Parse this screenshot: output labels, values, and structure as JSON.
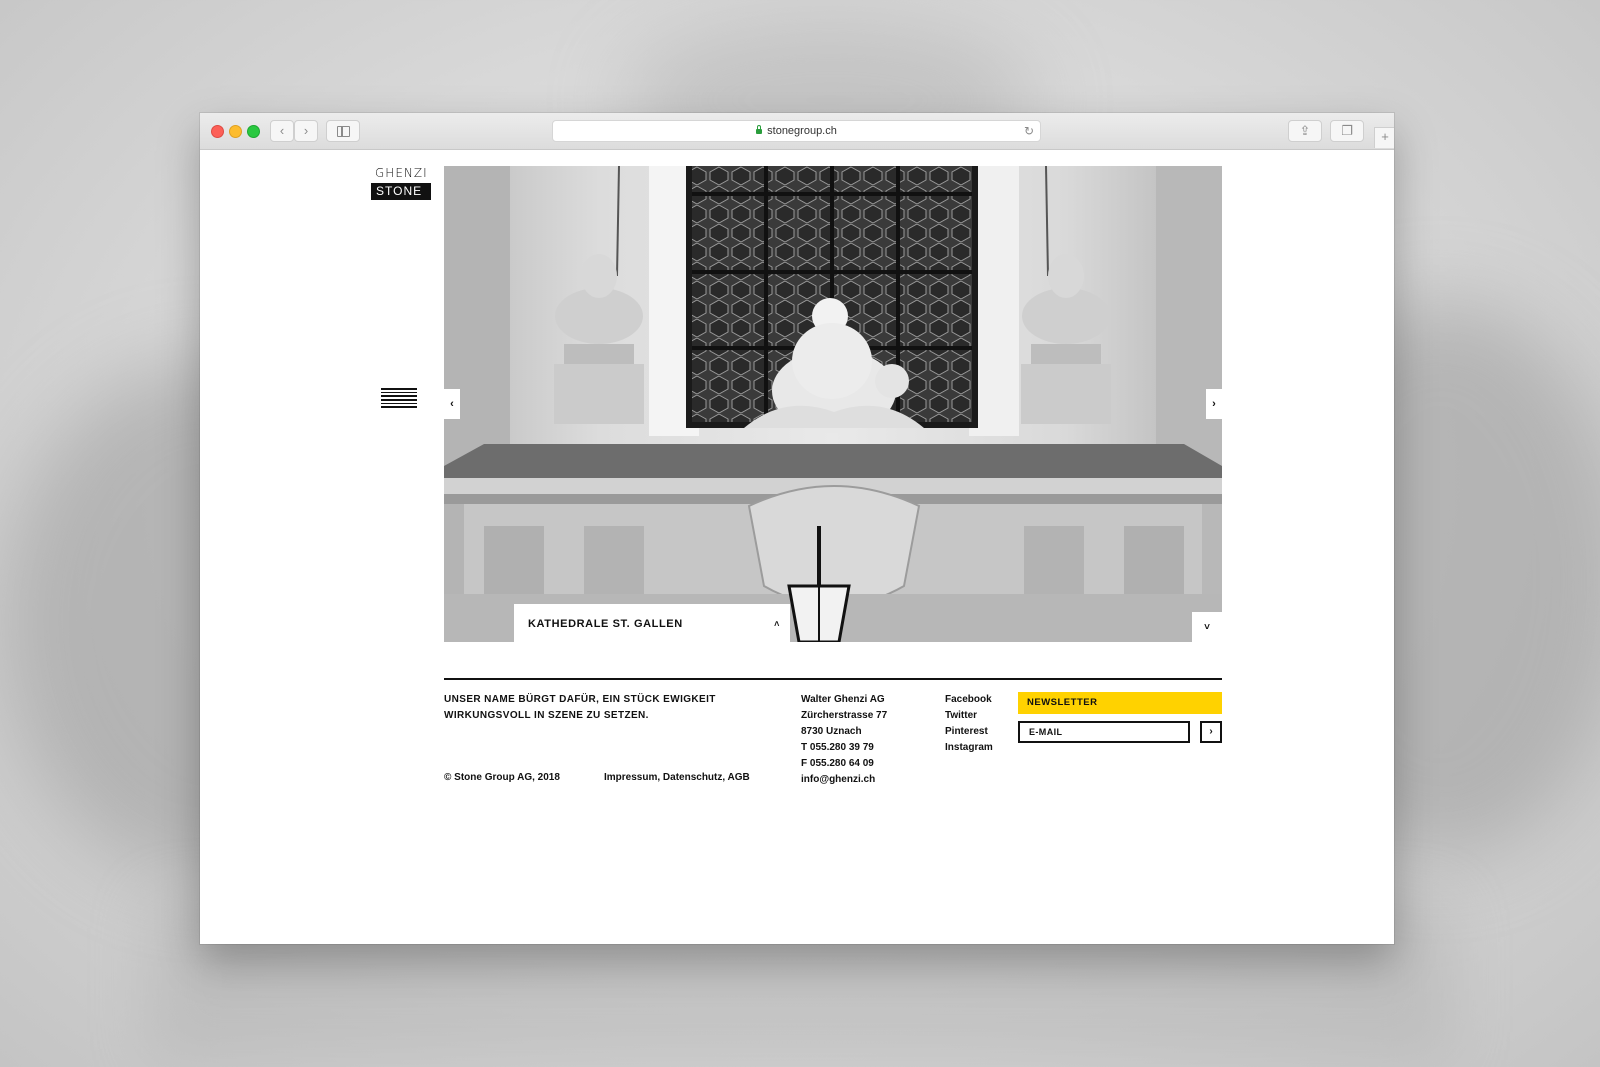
{
  "browser": {
    "url": "stonegroup.ch",
    "back_icon": "‹",
    "forward_icon": "›",
    "reload_icon": "↻",
    "share_icon": "⇪",
    "tabs_icon": "❐",
    "newtab_icon": "+"
  },
  "logo": {
    "top": "GHENZI",
    "bottom": "STONE"
  },
  "slider": {
    "caption": "KATHEDRALE ST. GALLEN",
    "caption_chevron": "˄",
    "prev": "‹",
    "next": "›",
    "scroll_down": "˅"
  },
  "footer": {
    "tagline": "UNSER NAME BÜRGT DAFÜR, EIN STÜCK EWIGKEIT WIRKUNGSVOLL IN SZENE ZU SETZEN.",
    "copyright": "© Stone Group AG, 2018",
    "legal": "Impressum, Datenschutz, AGB",
    "address": [
      "Walter Ghenzi AG",
      "Zürcherstrasse 77",
      "8730 Uznach",
      "T 055.280 39 79",
      "F 055.280 64 09",
      "info@ghenzi.ch"
    ],
    "social": [
      "Facebook",
      "Twitter",
      "Pinterest",
      "Instagram"
    ]
  },
  "newsletter": {
    "title": "NEWSLETTER",
    "placeholder": "E-MAIL",
    "submit": "›"
  },
  "colors": {
    "accent": "#ffd200",
    "text": "#111111"
  }
}
